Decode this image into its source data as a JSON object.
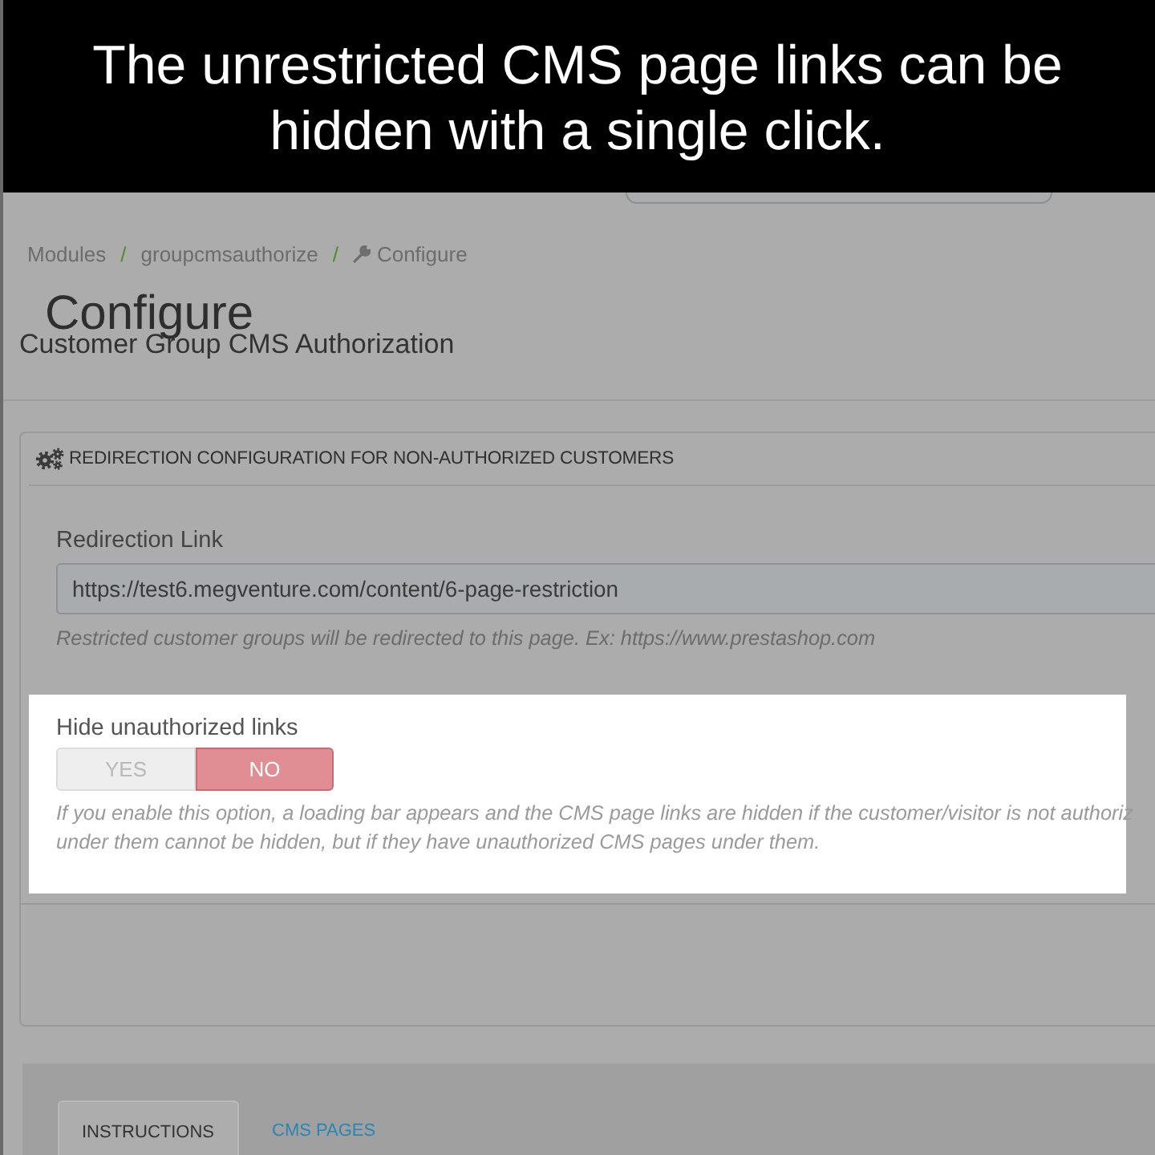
{
  "caption": "The unrestricted CMS page links can be hidden with a single click.",
  "breadcrumb": [
    {
      "kind": "link",
      "text": "Modules"
    },
    {
      "kind": "separator",
      "text": "/"
    },
    {
      "kind": "link",
      "text": "groupcmsauthorize"
    },
    {
      "kind": "separator",
      "text": "/"
    },
    {
      "kind": "current",
      "text": "Configure"
    }
  ],
  "page_title": "Configure",
  "page_subtitle": "Customer Group CMS Authorization",
  "panel": {
    "title": "REDIRECTION CONFIGURATION FOR NON-AUTHORIZED CUSTOMERS",
    "fields": [
      {
        "kind": "text",
        "label": "Redirection Link",
        "value": "https://test6.megventure.com/content/6-page-restriction",
        "help": [
          "Restricted customer groups will be redirected to this page. Ex: https://www.prestashop.com"
        ],
        "highlighted": false
      },
      {
        "kind": "switch",
        "label": "Hide unauthorized links",
        "options": [
          {
            "kind": "yes",
            "label": "YES",
            "selected": false
          },
          {
            "kind": "no",
            "label": "NO",
            "selected": true
          }
        ],
        "help": [
          "If you enable this option, a loading bar appears and the CMS page links are hidden if the customer/visitor is not authoriz",
          "under them cannot be hidden, but if they have unauthorized CMS pages under them."
        ],
        "highlighted": true
      }
    ]
  },
  "tabs": [
    {
      "label": "INSTRUCTIONS",
      "selected": true
    },
    {
      "label": "CMS PAGES",
      "selected": false
    }
  ]
}
